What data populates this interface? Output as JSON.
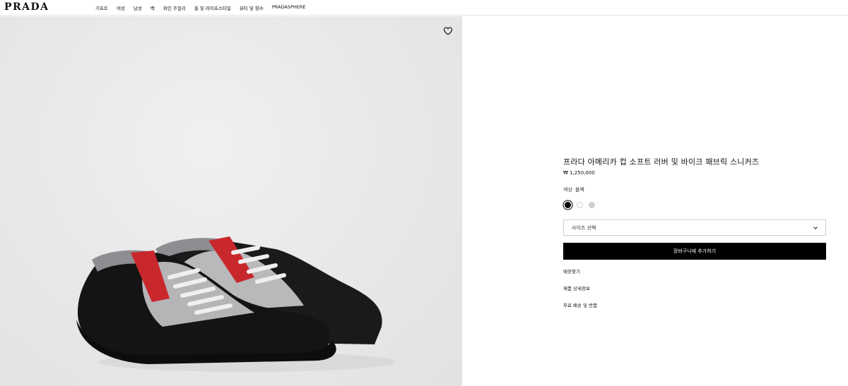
{
  "header": {
    "logo": "PRADA",
    "nav": [
      "기프트",
      "여성",
      "남성",
      "백",
      "파인 주얼리",
      "홈 및 라이프스타일",
      "뷰티 및 향수",
      "PRADASPHERE"
    ]
  },
  "product": {
    "title": "프라다 아메리카 컵 소프트 러버 및 바이크 패브릭 스니커즈",
    "price": "₩ 1,250,000",
    "color_label": "색상",
    "color_value": "블랙",
    "swatches": [
      "black",
      "white",
      "grey"
    ],
    "size_placeholder": "사이즈 선택",
    "add_to_cart": "장바구니에 추가하기",
    "links": [
      "매장찾기",
      "제품 상세정보",
      "무료 배송 및 반품"
    ]
  },
  "icons": {
    "wishlist": "heart-icon",
    "size_dropdown": "chevron-down-icon"
  },
  "colors": {
    "accent": "#000000",
    "background": "#ffffff",
    "media_bg": "#e9e9e9"
  }
}
